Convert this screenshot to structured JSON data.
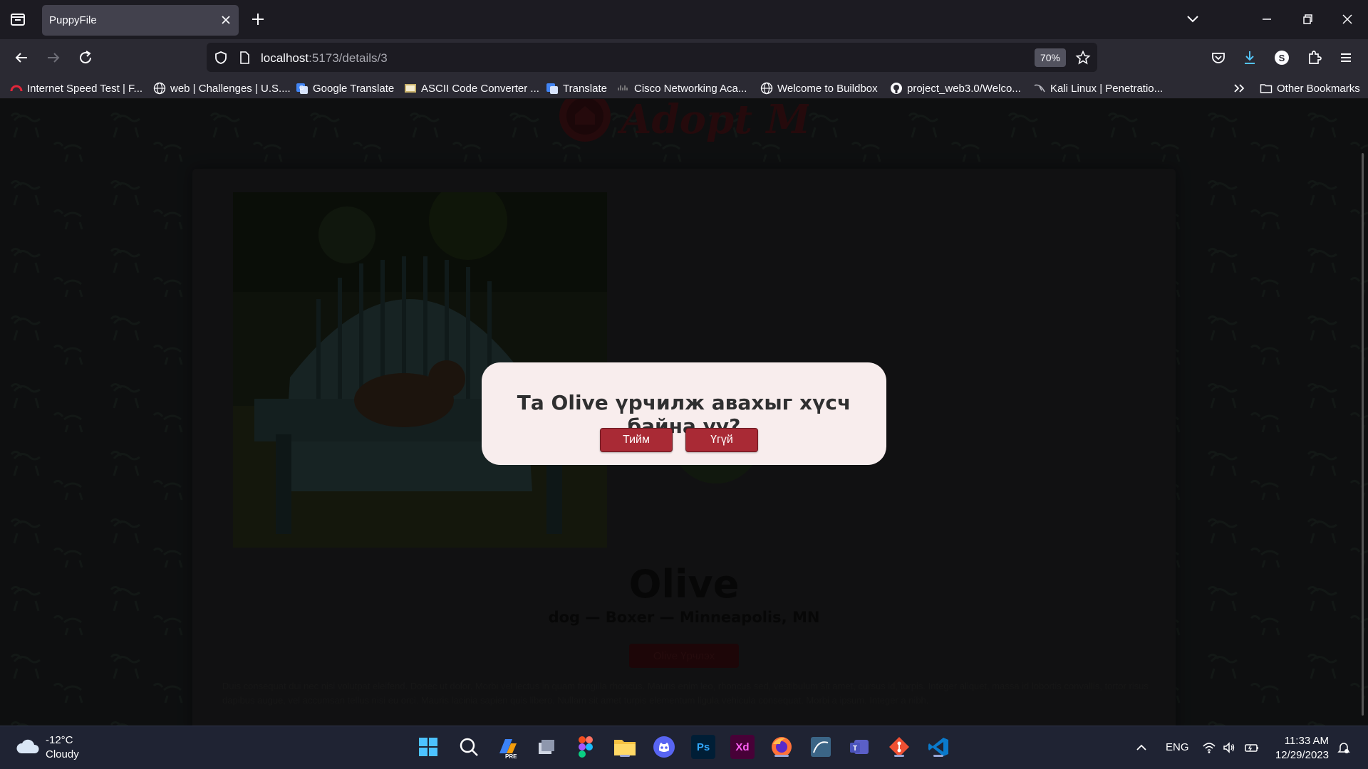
{
  "browser": {
    "tab_title": "PuppyFile",
    "url_host": "localhost",
    "url_path": ":5173/details/3",
    "zoom": "70%",
    "bookmarks": [
      {
        "label": "Internet Speed Test | F...",
        "icon": "speedometer-icon"
      },
      {
        "label": "web | Challenges | U.S....",
        "icon": "globe-icon"
      },
      {
        "label": "Google Translate",
        "icon": "translate-icon"
      },
      {
        "label": "ASCII Code Converter ...",
        "icon": "ascii-icon"
      },
      {
        "label": "Translate",
        "icon": "translate-icon"
      },
      {
        "label": "Cisco Networking Aca...",
        "icon": "cisco-icon"
      },
      {
        "label": "Welcome to Buildbox",
        "icon": "globe-icon"
      },
      {
        "label": "project_web3.0/Welco...",
        "icon": "github-icon"
      },
      {
        "label": "Kali Linux | Penetratio...",
        "icon": "kali-icon"
      }
    ],
    "other_bookmarks": "Other Bookmarks"
  },
  "page": {
    "logo_text": "Adopt Me!",
    "pet_name": "Olive",
    "pet_subtitle": "dog — Boxer — Minneapolis, MN",
    "adopt_button": "Olive Үрчлэх",
    "description": "Duis consequat dui nec nisi volutpat eleifend. Donec ut dolor. Morbi vel lectus in quam fringilla rhoncus. Mauris enim leo, rhoncus sed, vestibulum sit amet, cursus id, turpis. Integer aliquet, massa id lobortis convallis, tortor risus dapibus augue, vel accumsan tellus nisi eu orci. Mauris lacinia sapien quis libero. Nullam sit amet turpis elementum ligula vehicula consequat. Morbi a ipsum. Integer a nibh."
  },
  "modal": {
    "question": "Та Olive үрчилж авахыг хүсч байна уу?",
    "yes_label": "Тийм",
    "no_label": "Үгүй"
  },
  "taskbar": {
    "temperature": "-12°C",
    "weather": "Cloudy",
    "language": "ENG",
    "time": "11:33 AM",
    "date": "12/29/2023",
    "apps": [
      "windows-start",
      "search",
      "copilot",
      "task-view",
      "figma",
      "file-explorer",
      "discord",
      "photoshop",
      "adobe-xd",
      "firefox",
      "mysql-workbench",
      "teams",
      "git",
      "vscode"
    ]
  },
  "colors": {
    "accent": "#a92a35",
    "modal_bg": "#f8eded",
    "chrome_bg": "#1c1b22",
    "toolbar_bg": "#2b2a33"
  }
}
